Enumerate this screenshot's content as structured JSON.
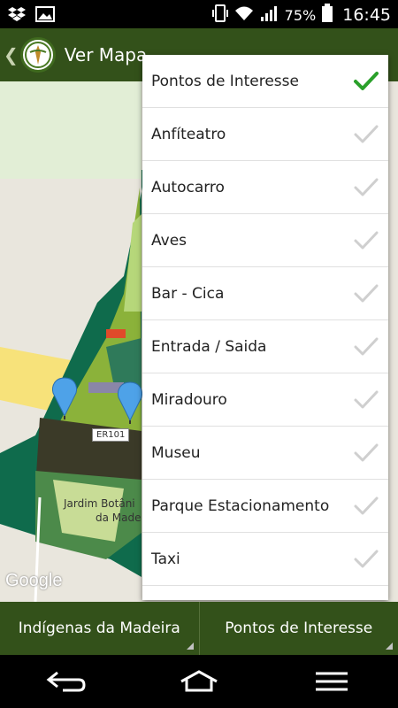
{
  "status": {
    "left_icons": [
      "dropbox-icon",
      "image-icon"
    ],
    "battery": "75%",
    "time": "16:45"
  },
  "appbar": {
    "title": "Ver Mapa"
  },
  "map": {
    "road_label": "ER101",
    "place_label_line1": "Jardim Botâni",
    "place_label_line2": "da Made",
    "attribution": "Google"
  },
  "dropdown": {
    "items": [
      {
        "label": "Pontos de Interesse",
        "checked": true
      },
      {
        "label": "Anfíteatro",
        "checked": false
      },
      {
        "label": "Autocarro",
        "checked": false
      },
      {
        "label": "Aves",
        "checked": false
      },
      {
        "label": "Bar - Cica",
        "checked": false
      },
      {
        "label": "Entrada / Saida",
        "checked": false
      },
      {
        "label": "Miradouro",
        "checked": false
      },
      {
        "label": "Museu",
        "checked": false
      },
      {
        "label": "Parque Estacionamento",
        "checked": false
      },
      {
        "label": "Taxi",
        "checked": false
      }
    ]
  },
  "tabs": {
    "left": "Indígenas da Madeira",
    "right": "Pontos de Interesse"
  },
  "colors": {
    "bar_green": "#33511a",
    "check_active": "#2aa02a",
    "check_inactive": "#cfcfcf"
  }
}
